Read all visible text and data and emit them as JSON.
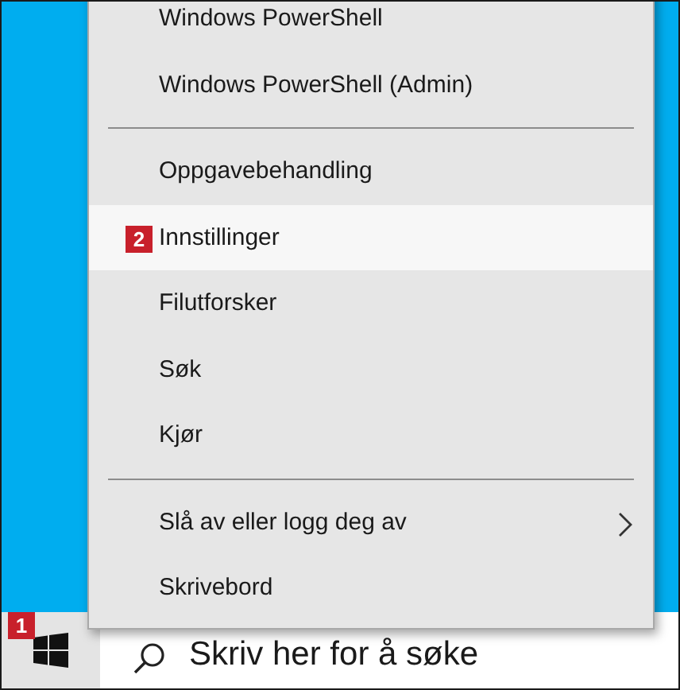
{
  "menu": {
    "items": [
      {
        "kind": "item",
        "label": "Windows PowerShell",
        "selected": false,
        "submenu": false
      },
      {
        "kind": "item",
        "label": "Windows PowerShell (Admin)",
        "selected": false,
        "submenu": false
      },
      {
        "kind": "separator"
      },
      {
        "kind": "item",
        "label": "Oppgavebehandling",
        "selected": false,
        "submenu": false
      },
      {
        "kind": "item",
        "label": "Innstillinger",
        "selected": true,
        "submenu": false,
        "badge": "2"
      },
      {
        "kind": "item",
        "label": "Filutforsker",
        "selected": false,
        "submenu": false
      },
      {
        "kind": "item",
        "label": "Søk",
        "selected": false,
        "submenu": false
      },
      {
        "kind": "item",
        "label": "Kjør",
        "selected": false,
        "submenu": false
      },
      {
        "kind": "separator"
      },
      {
        "kind": "item",
        "label": "Slå av eller logg deg av",
        "selected": false,
        "submenu": true
      },
      {
        "kind": "item",
        "label": "Skrivebord",
        "selected": false,
        "submenu": false
      }
    ]
  },
  "taskbar": {
    "start_badge": "1",
    "search": {
      "placeholder": "Skriv her for å søke"
    }
  }
}
